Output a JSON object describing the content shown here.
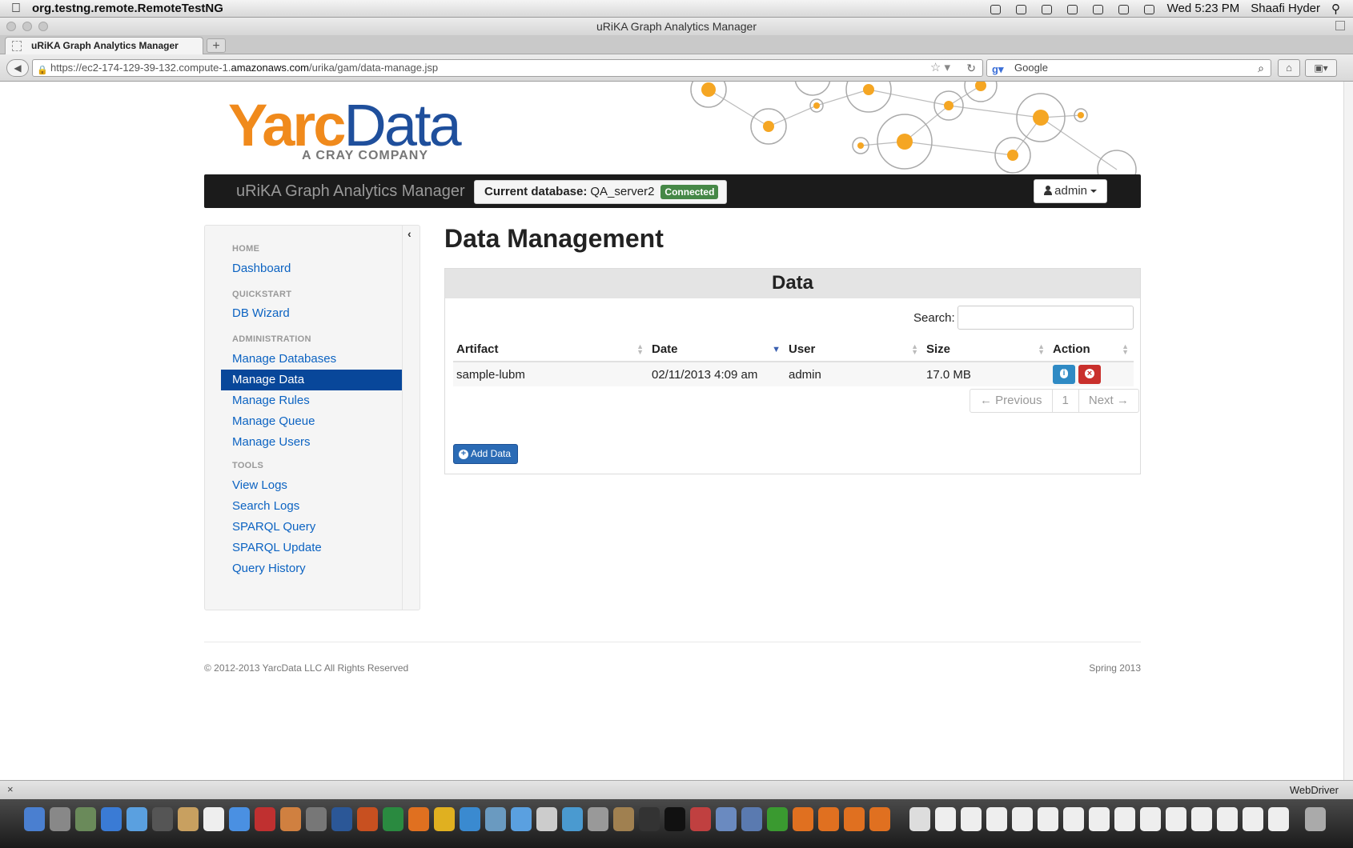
{
  "menubar": {
    "app_name": "org.testng.remote.RemoteTestNG",
    "clock": "Wed 5:23 PM",
    "user": "Shaafi Hyder"
  },
  "window": {
    "title": "uRiKA Graph Analytics Manager",
    "tab_title": "uRiKA Graph Analytics Manager",
    "url_prefix": "https://ec2-174-129-39-132.compute-1.",
    "url_domain": "amazonaws.com",
    "url_path": "/urika/gam/data-manage.jsp",
    "search_engine_placeholder": "Google"
  },
  "header": {
    "logo_yarc": "Yarc",
    "logo_data": "Data",
    "logo_tagline": "A CRAY COMPANY",
    "brand": "uRiKA Graph Analytics Manager",
    "db_label": "Current database:",
    "db_name": "QA_server2",
    "db_status": "Connected",
    "user_menu": "admin"
  },
  "sidebar": {
    "sections": [
      {
        "header": "HOME",
        "items": [
          "Dashboard"
        ]
      },
      {
        "header": "QUICKSTART",
        "items": [
          "DB Wizard"
        ]
      },
      {
        "header": "ADMINISTRATION",
        "items": [
          "Manage Databases",
          "Manage Data",
          "Manage Rules",
          "Manage Queue",
          "Manage Users"
        ]
      },
      {
        "header": "TOOLS",
        "items": [
          "View Logs",
          "Search Logs",
          "SPARQL Query",
          "SPARQL Update",
          "Query History"
        ]
      }
    ],
    "active_item": "Manage Data"
  },
  "main": {
    "title": "Data Management",
    "panel_title": "Data",
    "search_label": "Search:",
    "search_value": "",
    "columns": [
      "Artifact",
      "Date",
      "User",
      "Size",
      "Action"
    ],
    "rows": [
      {
        "artifact": "sample-lubm",
        "date": "02/11/2013 4:09 am",
        "user": "admin",
        "size": "17.0 MB"
      }
    ],
    "pagination": {
      "prev": "← Previous",
      "page": "1",
      "next": "Next →"
    },
    "add_button": "Add Data"
  },
  "footer": {
    "copyright": "© 2012-2013 YarcData LLC All Rights Reserved",
    "release": "Spring 2013"
  },
  "statusbar": {
    "right_text": "WebDriver"
  },
  "colors": {
    "accent": "#08479a",
    "link": "#0c63c2",
    "logo_orange": "#f08a1c",
    "logo_blue": "#1f4f9c",
    "connected": "#468847",
    "delete": "#c9302c",
    "info": "#2f8ac4"
  }
}
